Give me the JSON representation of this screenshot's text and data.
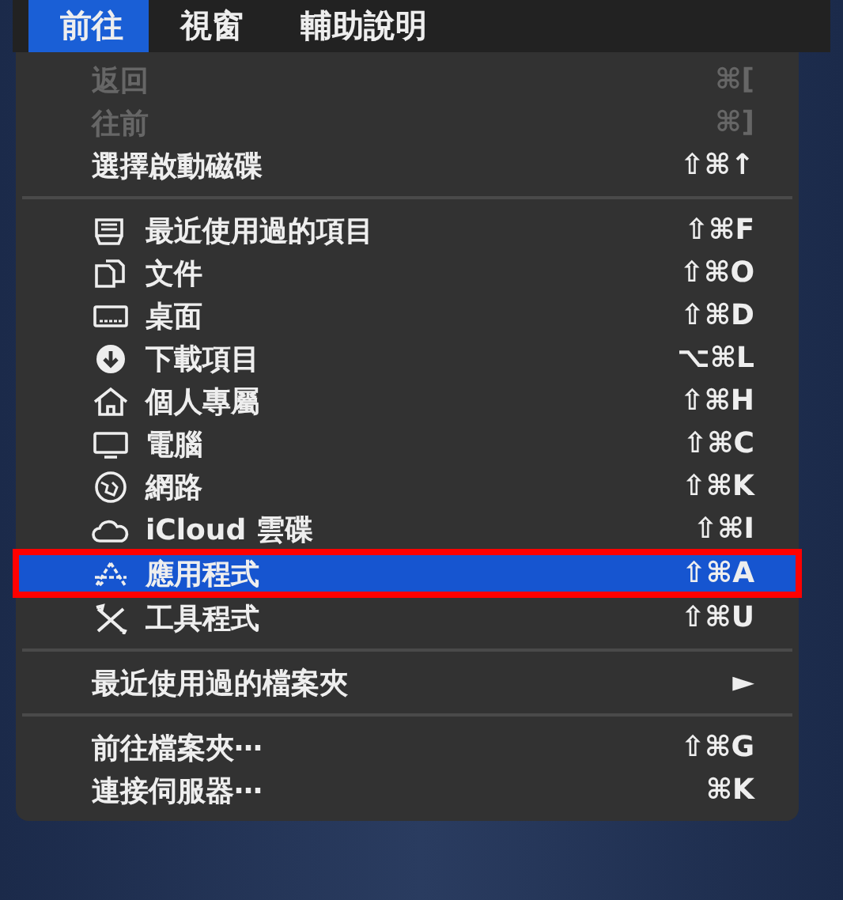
{
  "menubar": [
    {
      "label": "前往",
      "selected": true
    },
    {
      "label": "視窗",
      "selected": false
    },
    {
      "label": "輔助說明",
      "selected": false
    }
  ],
  "groups": [
    {
      "items": [
        {
          "kind": "plain",
          "label": "返回",
          "shortcut": "⌘[",
          "disabled": true,
          "selected": false
        },
        {
          "kind": "plain",
          "label": "往前",
          "shortcut": "⌘]",
          "disabled": true,
          "selected": false
        },
        {
          "kind": "plain",
          "label": "選擇啟動磁碟",
          "shortcut": "⇧⌘↑",
          "disabled": false,
          "selected": false
        }
      ]
    },
    {
      "items": [
        {
          "kind": "icon",
          "label": "最近使用過的項目",
          "shortcut": "⇧⌘F",
          "disabled": false,
          "selected": false
        },
        {
          "kind": "icon",
          "label": "文件",
          "shortcut": "⇧⌘O",
          "disabled": false,
          "selected": false
        },
        {
          "kind": "icon",
          "label": "桌面",
          "shortcut": "⇧⌘D",
          "disabled": false,
          "selected": false
        },
        {
          "kind": "icon",
          "label": "下載項目",
          "shortcut": "⌥⌘L",
          "disabled": false,
          "selected": false
        },
        {
          "kind": "icon",
          "label": "個人專屬",
          "shortcut": "⇧⌘H",
          "disabled": false,
          "selected": false
        },
        {
          "kind": "icon",
          "label": "電腦",
          "shortcut": "⇧⌘C",
          "disabled": false,
          "selected": false
        },
        {
          "kind": "icon",
          "label": "網路",
          "shortcut": "⇧⌘K",
          "disabled": false,
          "selected": false
        },
        {
          "kind": "icon",
          "label": "iCloud 雲碟",
          "shortcut": "⇧⌘I",
          "disabled": false,
          "selected": false
        },
        {
          "kind": "icon",
          "label": "應用程式",
          "shortcut": "⇧⌘A",
          "disabled": false,
          "selected": true
        },
        {
          "kind": "icon",
          "label": "工具程式",
          "shortcut": "⇧⌘U",
          "disabled": false,
          "selected": false
        }
      ]
    },
    {
      "items": [
        {
          "kind": "plain",
          "label": "最近使用過的檔案夾",
          "shortcut": "►",
          "disabled": false,
          "selected": false
        }
      ]
    },
    {
      "items": [
        {
          "kind": "plain",
          "label": "前往檔案夾⋯",
          "shortcut": "⇧⌘G",
          "disabled": false,
          "selected": false
        },
        {
          "kind": "plain",
          "label": "連接伺服器⋯",
          "shortcut": "⌘K",
          "disabled": false,
          "selected": false
        }
      ]
    }
  ]
}
